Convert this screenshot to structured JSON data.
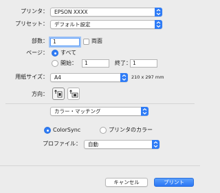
{
  "printer": {
    "label": "プリンタ：",
    "value": "EPSON XXXX"
  },
  "preset": {
    "label": "プリセット：",
    "value": "デフォルト設定"
  },
  "copies": {
    "label": "部数：",
    "value": "1",
    "duplex_label": "両面"
  },
  "pages": {
    "label": "ページ：",
    "all_label": "すべて",
    "start_label": "開始：",
    "start_value": "1",
    "end_label": "終了：",
    "end_value": "1"
  },
  "paper_size": {
    "label": "用紙サイズ：",
    "value": "A4",
    "dimensions": "210 x 297 mm"
  },
  "orientation": {
    "label": "方向："
  },
  "section_menu": {
    "value": "カラー・マッチング"
  },
  "color_matching": {
    "colorsync_label": "ColorSync",
    "printer_color_label": "プリンタのカラー",
    "selected": "ColorSync"
  },
  "profile": {
    "label": "プロファイル：",
    "value": "自動"
  },
  "buttons": {
    "cancel": "キャンセル",
    "print": "プリント"
  },
  "colors": {
    "accent": "#2f7cf6",
    "background": "#ececec"
  }
}
